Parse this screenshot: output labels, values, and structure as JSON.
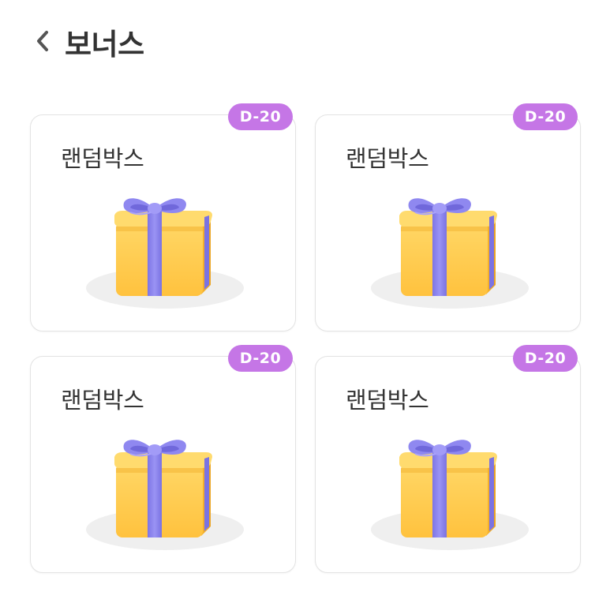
{
  "header": {
    "back_icon": "chevron-left-icon",
    "title": "보너스"
  },
  "cards": [
    {
      "title": "랜덤박스",
      "badge": "D-20",
      "icon": "gift-box-icon"
    },
    {
      "title": "랜덤박스",
      "badge": "D-20",
      "icon": "gift-box-icon"
    },
    {
      "title": "랜덤박스",
      "badge": "D-20",
      "icon": "gift-box-icon"
    },
    {
      "title": "랜덤박스",
      "badge": "D-20",
      "icon": "gift-box-icon"
    }
  ],
  "colors": {
    "badge": "#c576e6",
    "box": "#ffcf55",
    "ribbon": "#8b84ee",
    "text": "#333333"
  }
}
